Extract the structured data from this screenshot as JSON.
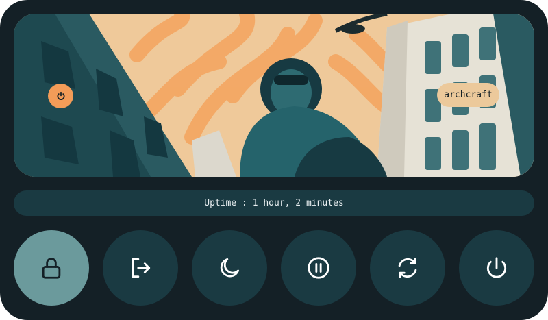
{
  "header": {
    "prompt_icon": "power-icon",
    "hostname": "archcraft",
    "background_image": "illustrated woman in sunglasses among city buildings under a sun with orange rays"
  },
  "status": {
    "uptime_text": "Uptime : 1 hour, 2 minutes"
  },
  "actions": [
    {
      "icon": "lock-icon",
      "selected": true
    },
    {
      "icon": "logout-icon",
      "selected": false
    },
    {
      "icon": "moon-icon",
      "selected": false
    },
    {
      "icon": "pause-icon",
      "selected": false
    },
    {
      "icon": "reboot-icon",
      "selected": false
    },
    {
      "icon": "power-icon",
      "selected": false
    }
  ],
  "colors": {
    "background": "#142026",
    "button": "#1a3a42",
    "button_selected": "#6b9a9c",
    "accent": "#f39c58",
    "pill": "#ecc99b"
  }
}
